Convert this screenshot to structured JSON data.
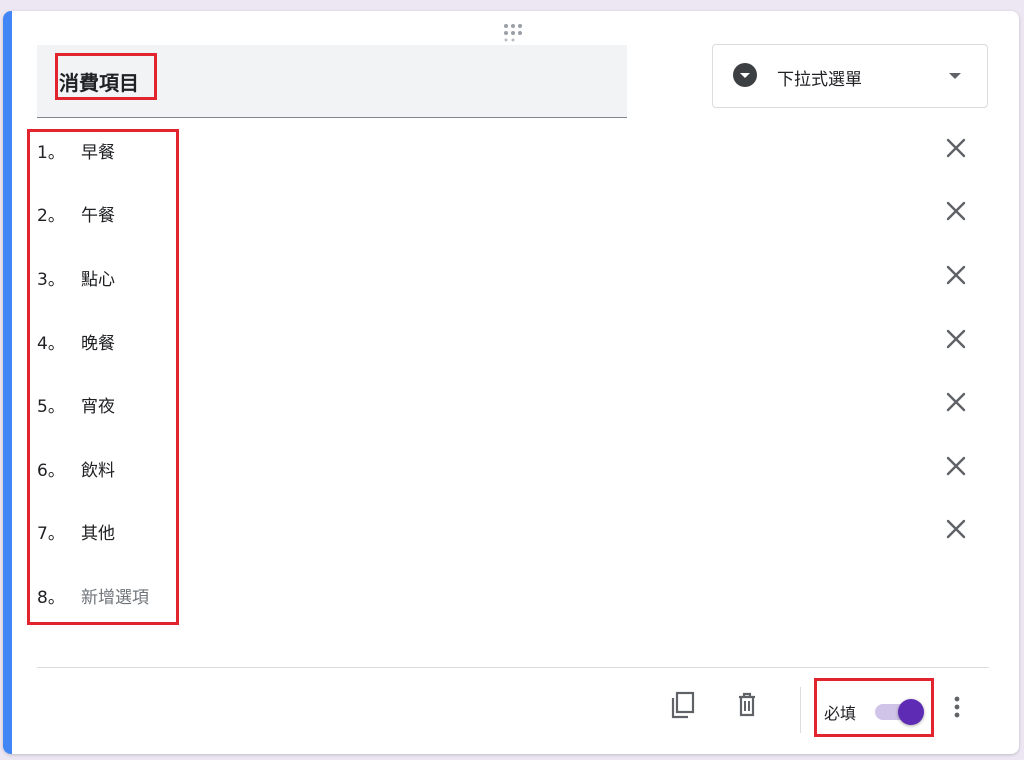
{
  "question": {
    "title": "消費項目",
    "type_label": "下拉式選單",
    "type_icon": "dropdown-circle-icon"
  },
  "options": [
    {
      "number": "1。",
      "label": "早餐"
    },
    {
      "number": "2。",
      "label": "午餐"
    },
    {
      "number": "3。",
      "label": "點心"
    },
    {
      "number": "4。",
      "label": "晚餐"
    },
    {
      "number": "5。",
      "label": "宵夜"
    },
    {
      "number": "6。",
      "label": "飲料"
    },
    {
      "number": "7。",
      "label": "其他"
    }
  ],
  "add_option": {
    "number": "8。",
    "placeholder": "新增選項"
  },
  "footer": {
    "required_label": "必填",
    "required_on": true,
    "icons": [
      "copy-icon",
      "trash-icon",
      "more-vert-icon"
    ]
  },
  "colors": {
    "accent": "#4285f4",
    "highlight": "#e2242f",
    "toggle_on": "#5e2bb5"
  }
}
